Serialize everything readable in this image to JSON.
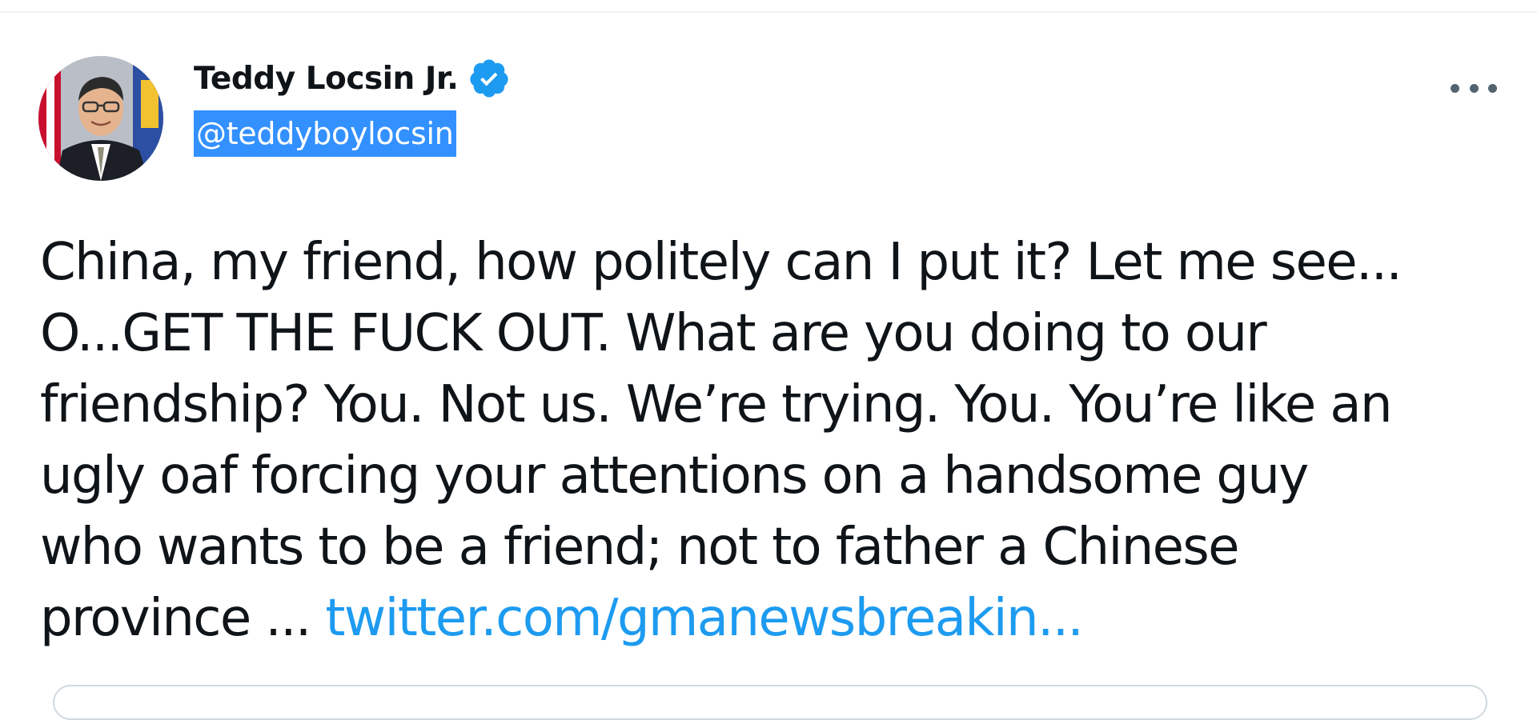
{
  "tweet": {
    "author": {
      "display_name": "Teddy Locsin Jr.",
      "handle": "@teddyboylocsin",
      "verified": true,
      "avatar_icon": "profile-photo"
    },
    "more_icon": "more-horizontal-icon",
    "text_lines": [
      "China, my friend, how politely can I put it? Let me see...",
      "O...GET THE FUCK OUT. What are you doing to our",
      "friendship? You. Not us. We’re trying. You. You’re like an",
      "ugly oaf forcing your attentions on a handsome guy",
      "who wants to be a friend; not to father a Chinese",
      "province ... "
    ],
    "link_text": "twitter.com/gmanewsbreakin...",
    "colors": {
      "text": "#0f1419",
      "link": "#1d9bf0",
      "verified_badge": "#1d9bf0",
      "selection_highlight": "#3390ff",
      "muted_icon": "#536471"
    }
  }
}
